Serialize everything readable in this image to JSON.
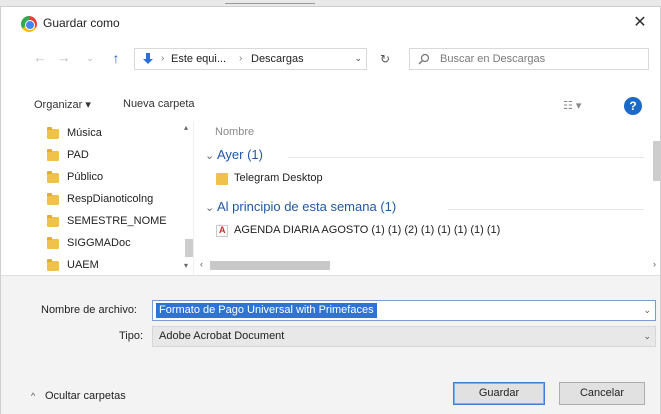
{
  "window": {
    "title": "Guardar como",
    "close_glyph": "✕",
    "app_icon": "chrome-icon"
  },
  "nav": {
    "back_glyph": "←",
    "forward_glyph": "→",
    "recent_glyph": "⌄",
    "up_glyph": "↑",
    "breadcrumbs": [
      "Este equi...",
      "Descargas"
    ],
    "separator": "›",
    "dropdown_glyph": "⌄",
    "refresh_glyph": "↻"
  },
  "search": {
    "placeholder": "Buscar en Descargas"
  },
  "toolbar": {
    "organize_label": "Organizar ▾",
    "new_folder_label": "Nueva carpeta",
    "view_glyph": "☷ ▾",
    "help_glyph": "?"
  },
  "sidebar": {
    "items": [
      {
        "label": "Música"
      },
      {
        "label": "PAD"
      },
      {
        "label": "Público"
      },
      {
        "label": "RespDianoticolng"
      },
      {
        "label": "SEMESTRE_NOME"
      },
      {
        "label": "SIGGMADoc"
      },
      {
        "label": "UAEM"
      }
    ],
    "scroll_up": "▴",
    "scroll_down": "▾"
  },
  "file_list": {
    "column_header": "Nombre",
    "groups": [
      {
        "label": "Ayer (1)",
        "files": [
          {
            "name": "Telegram Desktop",
            "type": "folder"
          }
        ]
      },
      {
        "label": "Al principio de esta semana (1)",
        "files": [
          {
            "name": "AGENDA DIARIA AGOSTO (1) (1) (2) (1) (1) (1) (1) (1)",
            "type": "pdf"
          }
        ]
      }
    ],
    "group_chevron": "⌄",
    "hscroll_left": "‹",
    "hscroll_right": "›"
  },
  "form": {
    "filename_label": "Nombre de archivo:",
    "filename_value": "Formato de Pago Universal with Primefaces",
    "type_label": "Tipo:",
    "type_value": "Adobe Acrobat Document",
    "dropdown_glyph": "⌄"
  },
  "footer": {
    "hide_folders_label": "Ocultar carpetas",
    "hide_folders_glyph": "^",
    "save_label": "Guardar",
    "cancel_label": "Cancelar"
  },
  "colors": {
    "accent": "#2e74d2",
    "link_blue": "#2159a8",
    "folder": "#f1c24b"
  }
}
